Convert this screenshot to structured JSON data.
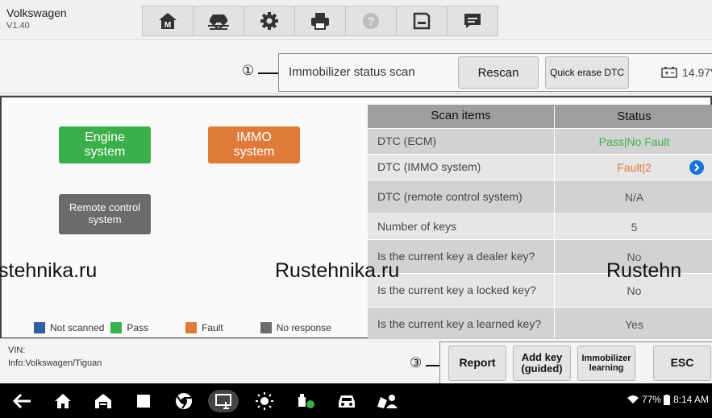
{
  "header": {
    "brand": "Volkswagen",
    "version": "V1.40",
    "toolbar_icons": [
      "home-icon",
      "vehicle-lift-icon",
      "gear-icon",
      "printer-icon",
      "help-icon",
      "save-icon",
      "message-icon"
    ],
    "home_letter": "M"
  },
  "subbar": {
    "callout_1": "①",
    "title": "Immobilizer status scan",
    "rescan": "Rescan",
    "quick_erase": "Quick erase DTC",
    "voltage": "14.97V"
  },
  "systems": {
    "engine": {
      "line1": "Engine",
      "line2": "system",
      "color": "#3bb04a"
    },
    "immo": {
      "line1": "IMMO",
      "line2": "system",
      "color": "#e07a3a"
    },
    "remote": {
      "line1": "Remote control",
      "line2": "system",
      "color": "#6b6b6b"
    }
  },
  "legend": [
    {
      "label": "Not scanned",
      "color": "#2f5fa0"
    },
    {
      "label": "Pass",
      "color": "#3bb04a"
    },
    {
      "label": "Fault",
      "color": "#e07a3a"
    },
    {
      "label": "No response",
      "color": "#6b6b6b"
    }
  ],
  "table": {
    "headers": [
      "Scan items",
      "Status"
    ],
    "rows": [
      {
        "item": "DTC (ECM)",
        "status": "Pass|No Fault",
        "status_color": "#3bb04a"
      },
      {
        "item": "DTC (IMMO system)",
        "status": "Fault|2",
        "status_color": "#e07a3a"
      },
      {
        "item": "DTC (remote control system)",
        "status": "N/A",
        "status_color": "#555555"
      },
      {
        "item": "Number of keys",
        "status": "5",
        "status_color": "#555555"
      },
      {
        "item": "Is the current key a dealer key?",
        "status": "No",
        "status_color": "#555555"
      },
      {
        "item": "Is the current key a locked key?",
        "status": "No",
        "status_color": "#555555"
      },
      {
        "item": "Is the current key a learned key?",
        "status": "Yes",
        "status_color": "#555555"
      }
    ]
  },
  "watermark": [
    "stehnika.ru",
    "Rustehnika.ru",
    "Rustehn"
  ],
  "footer": {
    "vin": "VIN:",
    "info": "Info:Volkswagen/Tiguan",
    "callout_3": "③",
    "report": "Report",
    "add_key_1": "Add key",
    "add_key_2": "(guided)",
    "immo_learn_1": "Immobilizer",
    "immo_learn_2": "learning",
    "esc": "ESC"
  },
  "statusbar": {
    "battery": "77%",
    "time": "8:14 AM"
  }
}
